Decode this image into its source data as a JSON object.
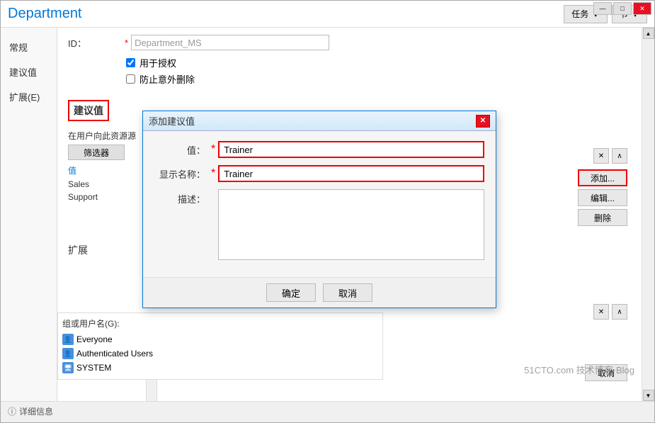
{
  "window": {
    "controls": {
      "minimize": "—",
      "maximize": "□",
      "close": "✕"
    }
  },
  "titlebar": {
    "title": "Department",
    "task_btn": "任务",
    "section_btn": "节"
  },
  "nav": {
    "items": [
      {
        "id": "general",
        "label": "常规"
      },
      {
        "id": "suggested",
        "label": "建议值"
      },
      {
        "id": "extend",
        "label": "扩展(E)"
      }
    ]
  },
  "form": {
    "id_label": "ID：",
    "id_value": "Department_MS",
    "id_required": "*",
    "checkbox1_label": "用于授权",
    "checkbox1_checked": true,
    "checkbox2_label": "防止意外删除",
    "checkbox2_checked": false
  },
  "suggested": {
    "section_label": "建议值",
    "source_label": "在用户向此资源源",
    "filter_label": "筛选器",
    "value_label": "值",
    "list_items": [
      "Sales",
      "Support"
    ],
    "add_btn": "添加...",
    "edit_btn": "编辑...",
    "delete_btn": "删除",
    "ctrl_x": "✕",
    "ctrl_up": "∧"
  },
  "extension": {
    "section_label": "扩展",
    "ctrl_x": "✕",
    "ctrl_up": "∧"
  },
  "dialog": {
    "title": "添加建议值",
    "close_btn": "✕",
    "value_label": "值：",
    "display_label": "显示名称：",
    "desc_label": "描述：",
    "value_input": "Trainer",
    "display_input": "Trainer",
    "value_required": "*",
    "display_required": "*",
    "ok_btn": "确定",
    "cancel_btn": "取消"
  },
  "users": {
    "label": "组或用户名(G):",
    "items": [
      {
        "icon": "👤",
        "name": "Everyone"
      },
      {
        "icon": "👤",
        "name": "Authenticated Users"
      },
      {
        "icon": "🖥",
        "name": "SYSTEM"
      }
    ]
  },
  "bottom": {
    "info_icon": "ⓘ",
    "info_label": "详细信息",
    "cancel_btn": "取消"
  },
  "watermark": {
    "text": "51CTO.com  技术博客·Blog"
  }
}
